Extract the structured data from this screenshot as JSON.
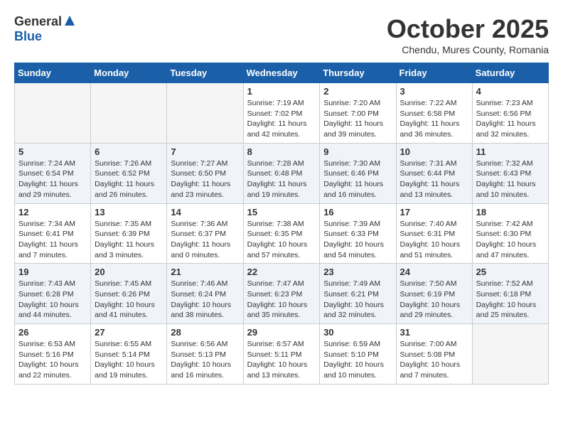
{
  "logo": {
    "general": "General",
    "blue": "Blue"
  },
  "title": "October 2025",
  "subtitle": "Chendu, Mures County, Romania",
  "days_of_week": [
    "Sunday",
    "Monday",
    "Tuesday",
    "Wednesday",
    "Thursday",
    "Friday",
    "Saturday"
  ],
  "weeks": [
    {
      "shaded": false,
      "days": [
        {
          "num": "",
          "info": ""
        },
        {
          "num": "",
          "info": ""
        },
        {
          "num": "",
          "info": ""
        },
        {
          "num": "1",
          "info": "Sunrise: 7:19 AM\nSunset: 7:02 PM\nDaylight: 11 hours and 42 minutes."
        },
        {
          "num": "2",
          "info": "Sunrise: 7:20 AM\nSunset: 7:00 PM\nDaylight: 11 hours and 39 minutes."
        },
        {
          "num": "3",
          "info": "Sunrise: 7:22 AM\nSunset: 6:58 PM\nDaylight: 11 hours and 36 minutes."
        },
        {
          "num": "4",
          "info": "Sunrise: 7:23 AM\nSunset: 6:56 PM\nDaylight: 11 hours and 32 minutes."
        }
      ]
    },
    {
      "shaded": true,
      "days": [
        {
          "num": "5",
          "info": "Sunrise: 7:24 AM\nSunset: 6:54 PM\nDaylight: 11 hours and 29 minutes."
        },
        {
          "num": "6",
          "info": "Sunrise: 7:26 AM\nSunset: 6:52 PM\nDaylight: 11 hours and 26 minutes."
        },
        {
          "num": "7",
          "info": "Sunrise: 7:27 AM\nSunset: 6:50 PM\nDaylight: 11 hours and 23 minutes."
        },
        {
          "num": "8",
          "info": "Sunrise: 7:28 AM\nSunset: 6:48 PM\nDaylight: 11 hours and 19 minutes."
        },
        {
          "num": "9",
          "info": "Sunrise: 7:30 AM\nSunset: 6:46 PM\nDaylight: 11 hours and 16 minutes."
        },
        {
          "num": "10",
          "info": "Sunrise: 7:31 AM\nSunset: 6:44 PM\nDaylight: 11 hours and 13 minutes."
        },
        {
          "num": "11",
          "info": "Sunrise: 7:32 AM\nSunset: 6:43 PM\nDaylight: 11 hours and 10 minutes."
        }
      ]
    },
    {
      "shaded": false,
      "days": [
        {
          "num": "12",
          "info": "Sunrise: 7:34 AM\nSunset: 6:41 PM\nDaylight: 11 hours and 7 minutes."
        },
        {
          "num": "13",
          "info": "Sunrise: 7:35 AM\nSunset: 6:39 PM\nDaylight: 11 hours and 3 minutes."
        },
        {
          "num": "14",
          "info": "Sunrise: 7:36 AM\nSunset: 6:37 PM\nDaylight: 11 hours and 0 minutes."
        },
        {
          "num": "15",
          "info": "Sunrise: 7:38 AM\nSunset: 6:35 PM\nDaylight: 10 hours and 57 minutes."
        },
        {
          "num": "16",
          "info": "Sunrise: 7:39 AM\nSunset: 6:33 PM\nDaylight: 10 hours and 54 minutes."
        },
        {
          "num": "17",
          "info": "Sunrise: 7:40 AM\nSunset: 6:31 PM\nDaylight: 10 hours and 51 minutes."
        },
        {
          "num": "18",
          "info": "Sunrise: 7:42 AM\nSunset: 6:30 PM\nDaylight: 10 hours and 47 minutes."
        }
      ]
    },
    {
      "shaded": true,
      "days": [
        {
          "num": "19",
          "info": "Sunrise: 7:43 AM\nSunset: 6:28 PM\nDaylight: 10 hours and 44 minutes."
        },
        {
          "num": "20",
          "info": "Sunrise: 7:45 AM\nSunset: 6:26 PM\nDaylight: 10 hours and 41 minutes."
        },
        {
          "num": "21",
          "info": "Sunrise: 7:46 AM\nSunset: 6:24 PM\nDaylight: 10 hours and 38 minutes."
        },
        {
          "num": "22",
          "info": "Sunrise: 7:47 AM\nSunset: 6:23 PM\nDaylight: 10 hours and 35 minutes."
        },
        {
          "num": "23",
          "info": "Sunrise: 7:49 AM\nSunset: 6:21 PM\nDaylight: 10 hours and 32 minutes."
        },
        {
          "num": "24",
          "info": "Sunrise: 7:50 AM\nSunset: 6:19 PM\nDaylight: 10 hours and 29 minutes."
        },
        {
          "num": "25",
          "info": "Sunrise: 7:52 AM\nSunset: 6:18 PM\nDaylight: 10 hours and 25 minutes."
        }
      ]
    },
    {
      "shaded": false,
      "days": [
        {
          "num": "26",
          "info": "Sunrise: 6:53 AM\nSunset: 5:16 PM\nDaylight: 10 hours and 22 minutes."
        },
        {
          "num": "27",
          "info": "Sunrise: 6:55 AM\nSunset: 5:14 PM\nDaylight: 10 hours and 19 minutes."
        },
        {
          "num": "28",
          "info": "Sunrise: 6:56 AM\nSunset: 5:13 PM\nDaylight: 10 hours and 16 minutes."
        },
        {
          "num": "29",
          "info": "Sunrise: 6:57 AM\nSunset: 5:11 PM\nDaylight: 10 hours and 13 minutes."
        },
        {
          "num": "30",
          "info": "Sunrise: 6:59 AM\nSunset: 5:10 PM\nDaylight: 10 hours and 10 minutes."
        },
        {
          "num": "31",
          "info": "Sunrise: 7:00 AM\nSunset: 5:08 PM\nDaylight: 10 hours and 7 minutes."
        },
        {
          "num": "",
          "info": ""
        }
      ]
    }
  ]
}
